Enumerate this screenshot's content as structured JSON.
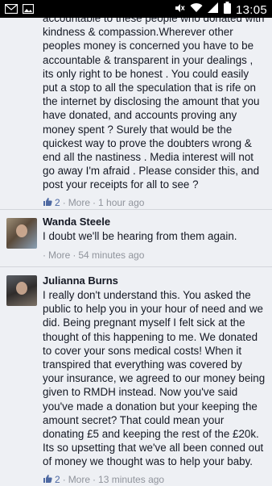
{
  "status_bar": {
    "time": "13:05",
    "icons": [
      "mail-icon",
      "image-icon",
      "mute-icon",
      "wifi-icon",
      "signal-icon",
      "battery-icon"
    ]
  },
  "comments": [
    {
      "partial_first_line": "accountable to these people who donated with",
      "text": "kindness & compassion.Wherever other peoples money is concerned you have to be accountable & transparent in your dealings , its only right to be honest . You could easily put a stop to all the speculation that is rife on the internet by disclosing the amount that you have donated, and accounts proving any money spent ? Surely that would be the quickest way to prove the doubters wrong & end all the nastiness . Media interest will not go away I'm afraid . Please consider this, and post your receipts for all to see ?",
      "likes": "2",
      "more": "More",
      "time": "1 hour ago"
    },
    {
      "author": "Wanda Steele",
      "text": "I doubt we'll be hearing from them again.",
      "more": "More",
      "time": "54 minutes ago"
    },
    {
      "author": "Julianna Burns",
      "text": "I really don't understand this. You asked the public to help you in your hour of need and we did. Being pregnant myself I felt sick at the thought of this happening to me. We donated to cover your sons medical costs! When it transpired that everything was covered by your insurance, we agreed to our money being given to RMDH instead. Now you've said you've made a donation but your keeping the amount secret? That could mean your donating £5 and keeping the rest of the £20k. Its so upsetting that we've all been conned out of money we thought was to help your baby.",
      "likes": "2",
      "more": "More",
      "time": "13 minutes ago"
    }
  ],
  "separator": "·"
}
